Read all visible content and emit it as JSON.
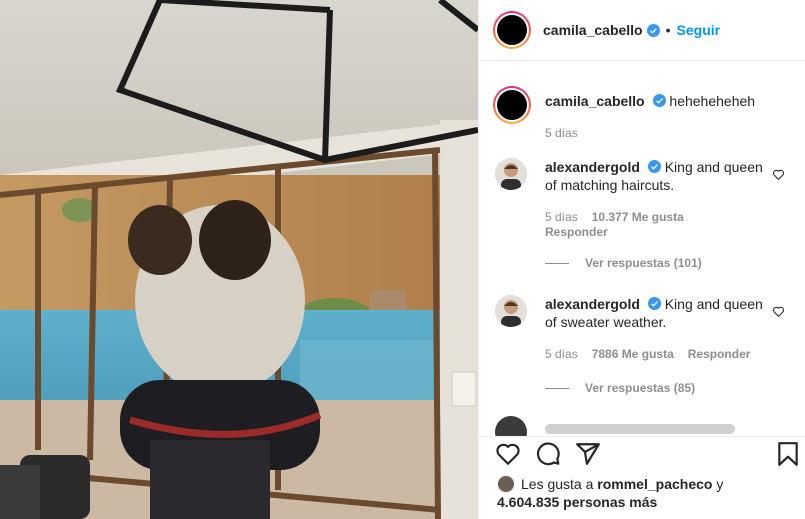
{
  "post": {
    "author": "camila_cabello",
    "follow_label": "Seguir",
    "separator": "•"
  },
  "caption": {
    "author": "camila_cabello",
    "text": "heheheheheh",
    "time": "5 días"
  },
  "comments": [
    {
      "author": "alexandergold",
      "text": "King and queen of matching haircuts.",
      "time": "5 días",
      "likes": "10.377 Me gusta",
      "reply_label": "Responder",
      "view_replies": "Ver respuestas (101)"
    },
    {
      "author": "alexandergold",
      "text": "King and queen of sweater weather.",
      "time": "5 días",
      "likes": "7886 Me gusta",
      "reply_label": "Responder",
      "view_replies": "Ver respuestas (85)"
    }
  ],
  "likes": {
    "prefix": "Les gusta a",
    "user": "rommel_pacheco",
    "conjunction": "y",
    "count": "4.604.835 personas más"
  },
  "icons": {
    "verified": "verified-badge-icon",
    "heart": "heart-icon",
    "comment": "comment-icon",
    "share": "paper-plane-icon",
    "save": "bookmark-icon"
  },
  "colors": {
    "link": "#0095f6",
    "verified": "#3897f0",
    "secondary_text": "#8e8e8e",
    "border": "#efefef"
  }
}
